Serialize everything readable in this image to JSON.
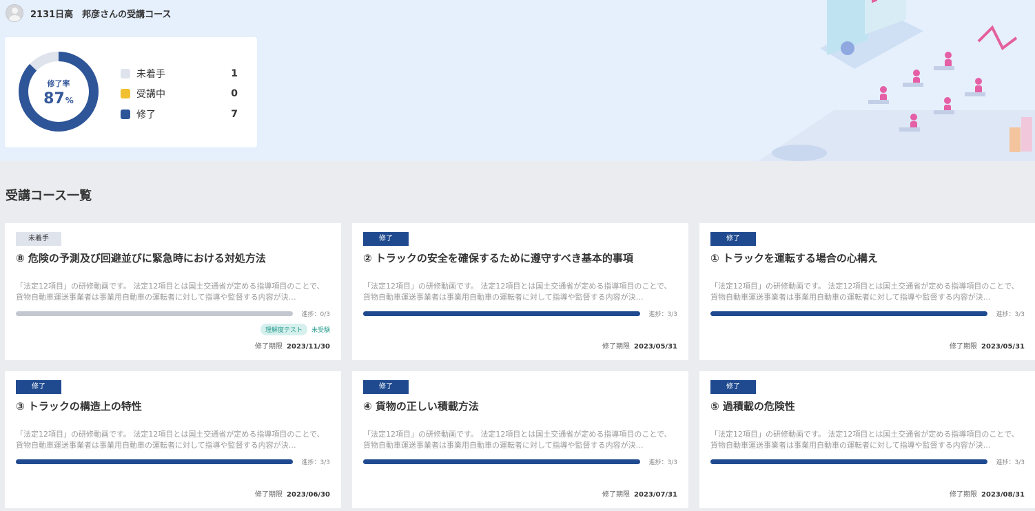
{
  "user": {
    "name": "2131日高　邦彦さんの受講コース"
  },
  "summary": {
    "rate_label": "修了率",
    "rate_value": "87",
    "rate_unit": "%",
    "rate_fraction": 0.87,
    "legend": [
      {
        "label": "未着手",
        "count": "1",
        "color": "#dfe3ec"
      },
      {
        "label": "受講中",
        "count": "0",
        "color": "#f0c030"
      },
      {
        "label": "修了",
        "count": "7",
        "color": "#2e5597"
      }
    ]
  },
  "section_title": "受講コース一覧",
  "cards": [
    {
      "status": "未着手",
      "status_kind": "notstart",
      "title": "⑧ 危険の予測及び回避並びに緊急時における対処方法",
      "desc": "「法定12項目」の研修動画です。 法定12項目とは国土交通省が定める指導項目のことで、貨物自動車運送事業者は事業用自動車の運転者に対して指導や監督する内容が決…",
      "progress_text": "進捗：0/3",
      "progress": 0,
      "test_tag": "理解度テスト",
      "test_status": "未受験",
      "deadline_label": "修了期限",
      "deadline": "2023/11/30"
    },
    {
      "status": "修了",
      "status_kind": "done",
      "title": "② トラックの安全を確保するために遵守すべき基本的事項",
      "desc": "「法定12項目」の研修動画です。 法定12項目とは国土交通省が定める指導項目のことで、貨物自動車運送事業者は事業用自動車の運転者に対して指導や監督する内容が決…",
      "progress_text": "進捗：3/3",
      "progress": 1,
      "deadline_label": "修了期限",
      "deadline": "2023/05/31"
    },
    {
      "status": "修了",
      "status_kind": "done",
      "title": "① トラックを運転する場合の心構え",
      "desc": "「法定12項目」の研修動画です。 法定12項目とは国土交通省が定める指導項目のことで、貨物自動車運送事業者は事業用自動車の運転者に対して指導や監督する内容が決…",
      "progress_text": "進捗：3/3",
      "progress": 1,
      "deadline_label": "修了期限",
      "deadline": "2023/05/31"
    },
    {
      "status": "修了",
      "status_kind": "done",
      "title": "③ トラックの構造上の特性",
      "desc": "「法定12項目」の研修動画です。 法定12項目とは国土交通省が定める指導項目のことで、貨物自動車運送事業者は事業用自動車の運転者に対して指導や監督する内容が決…",
      "progress_text": "進捗：3/3",
      "progress": 1,
      "deadline_label": "修了期限",
      "deadline": "2023/06/30"
    },
    {
      "status": "修了",
      "status_kind": "done",
      "title": "④ 貨物の正しい積載方法",
      "desc": "「法定12項目」の研修動画です。 法定12項目とは国土交通省が定める指導項目のことで、貨物自動車運送事業者は事業用自動車の運転者に対して指導や監督する内容が決…",
      "progress_text": "進捗：3/3",
      "progress": 1,
      "deadline_label": "修了期限",
      "deadline": "2023/07/31"
    },
    {
      "status": "修了",
      "status_kind": "done",
      "title": "⑤ 過積載の危険性",
      "desc": "「法定12項目」の研修動画です。 法定12項目とは国土交通省が定める指導項目のことで、貨物自動車運送事業者は事業用自動車の運転者に対して指導や監督する内容が決…",
      "progress_text": "進捗：3/3",
      "progress": 1,
      "deadline_label": "修了期限",
      "deadline": "2023/08/31"
    }
  ]
}
